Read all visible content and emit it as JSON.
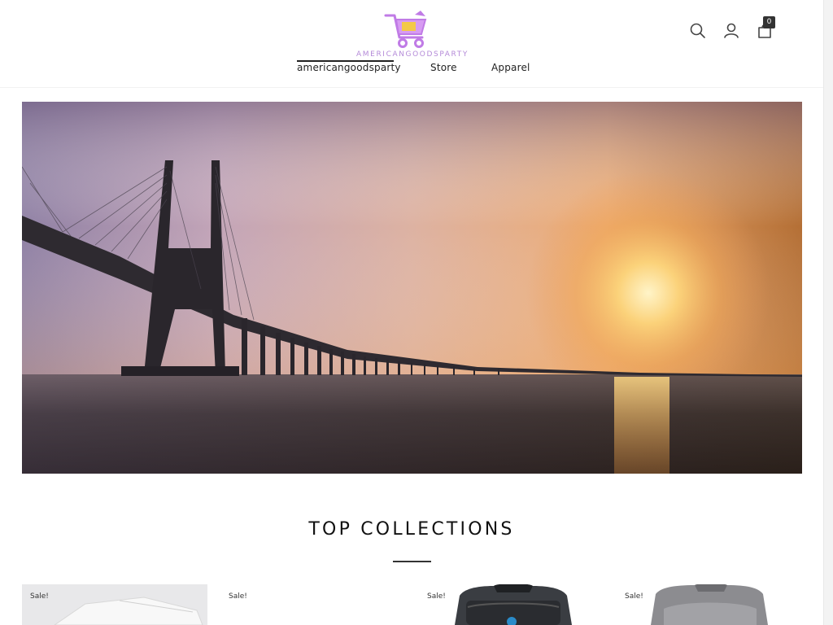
{
  "brand": {
    "logo_text": "AMERICANGOODSPARTY"
  },
  "nav": {
    "items": [
      {
        "label": "americangoodsparty"
      },
      {
        "label": "Store"
      },
      {
        "label": "Apparel"
      }
    ]
  },
  "header_icons": {
    "search": "search-icon",
    "account": "user-icon",
    "cart": "cart-icon",
    "cart_count": "0"
  },
  "collections": {
    "title": "TOP COLLECTIONS",
    "products": [
      {
        "badge": "Sale!"
      },
      {
        "badge": "Sale!"
      },
      {
        "badge": "Sale!"
      },
      {
        "badge": "Sale!"
      }
    ]
  },
  "colors": {
    "logo_accent": "#b48ad8",
    "cart_badge": "#333333",
    "text": "#222222"
  }
}
